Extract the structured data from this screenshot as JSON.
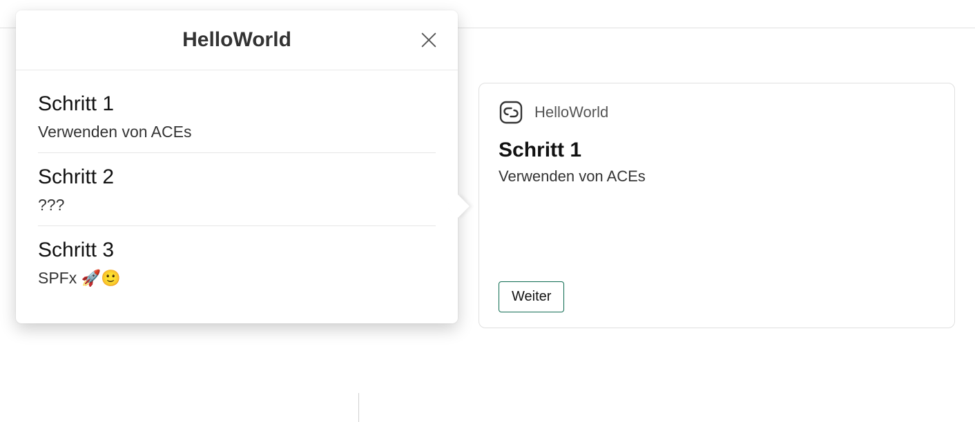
{
  "callout": {
    "title": "HelloWorld",
    "steps": [
      {
        "title": "Schritt 1",
        "desc": "Verwenden von ACEs"
      },
      {
        "title": "Schritt 2",
        "desc": "???"
      },
      {
        "title": "Schritt 3",
        "desc": "SPFx 🚀🙂"
      }
    ]
  },
  "card": {
    "header": "HelloWorld",
    "title": "Schritt 1",
    "subtitle": "Verwenden von ACEs",
    "button": "Weiter"
  }
}
